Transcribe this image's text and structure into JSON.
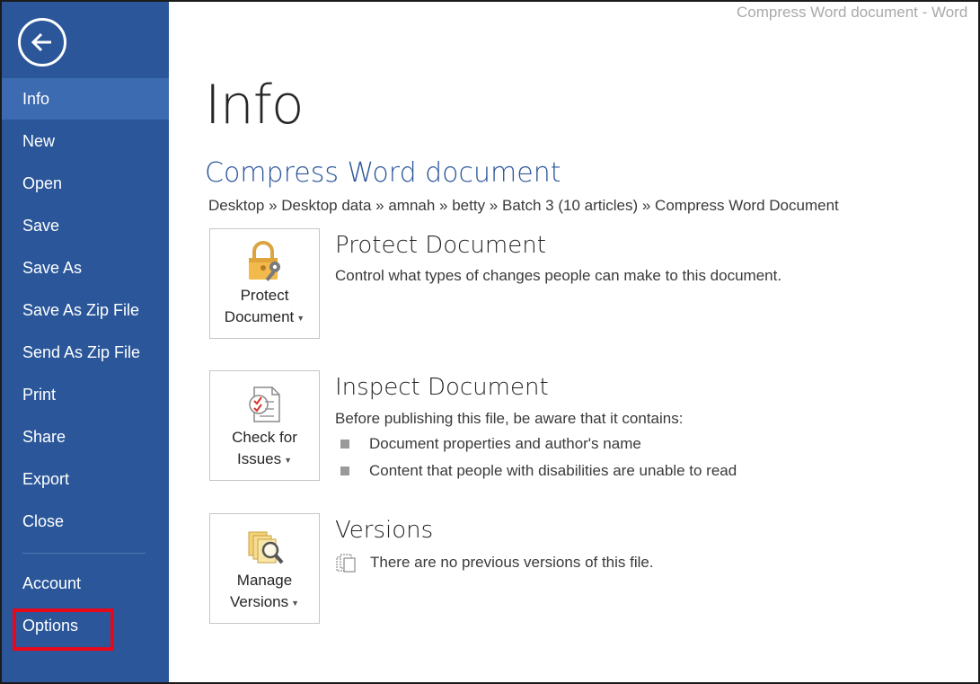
{
  "window": {
    "title": "Compress Word document - Word"
  },
  "sidebar": {
    "items": [
      {
        "label": "Info"
      },
      {
        "label": "New"
      },
      {
        "label": "Open"
      },
      {
        "label": "Save"
      },
      {
        "label": "Save As"
      },
      {
        "label": "Save As Zip File"
      },
      {
        "label": "Send As Zip File"
      },
      {
        "label": "Print"
      },
      {
        "label": "Share"
      },
      {
        "label": "Export"
      },
      {
        "label": "Close"
      },
      {
        "label": "Account"
      },
      {
        "label": "Options"
      }
    ],
    "active": "Info",
    "highlighted": "Options"
  },
  "main": {
    "page_title": "Info",
    "doc_title": "Compress Word document",
    "breadcrumb": "Desktop » Desktop data » amnah » betty » Batch 3 (10 articles) » Compress Word Document",
    "protect": {
      "tile_line1": "Protect",
      "tile_line2": "Document",
      "title": "Protect Document",
      "desc": "Control what types of changes people can make to this document.",
      "icon": "lock-key-icon"
    },
    "inspect": {
      "tile_line1": "Check for",
      "tile_line2": "Issues",
      "title": "Inspect Document",
      "desc": "Before publishing this file, be aware that it contains:",
      "bullets": [
        "Document properties and author's name",
        "Content that people with disabilities are unable to read"
      ],
      "icon": "checklist-icon"
    },
    "versions": {
      "tile_line1": "Manage",
      "tile_line2": "Versions",
      "title": "Versions",
      "desc": "There are no previous versions of this file.",
      "icon": "versions-search-icon"
    }
  },
  "colors": {
    "sidebar_bg": "#2b579a",
    "sidebar_active": "#3c6bb1",
    "accent": "#2b579a",
    "highlight": "#e8081a"
  }
}
